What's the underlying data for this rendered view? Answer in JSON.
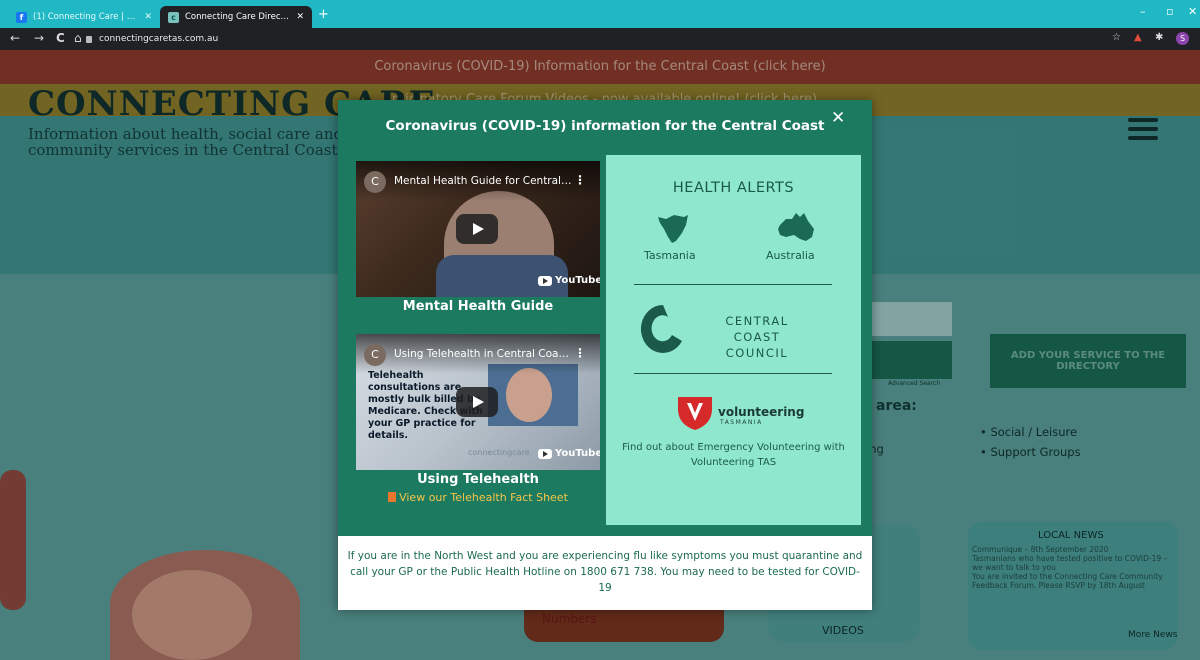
{
  "browser": {
    "tabs": [
      {
        "title": "(1) Connecting Care | Facebook",
        "favicon": "facebook-icon",
        "close": "✕"
      },
      {
        "title": "Connecting Care Directory – Find",
        "favicon": "site-icon",
        "close": "✕"
      }
    ],
    "url": "connectingcaretas.com.au",
    "profile_initial": "S"
  },
  "page": {
    "banner_covid": "Coronavirus (COVID-19) Information for the Central Coast (click here)",
    "banner_forum": "Anticipatory Care Forum Videos - now available online! (click here)",
    "logo_title": "CONNECTING CARE",
    "logo_subtitle": "Information about health, social care and community services in the Central Coast",
    "advanced_search": "Advanced Search",
    "add_service": "ADD YOUR SERVICE TO THE DIRECTORY",
    "area_heading": "area:",
    "categories": [
      "Social / Leisure",
      "Support Groups"
    ],
    "category_fragments": [
      "s",
      "ing"
    ],
    "numbers_label": "Numbers",
    "videos_label": "VIDEOS",
    "news": {
      "title": "LOCAL NEWS",
      "items": [
        "Communique – 8th September 2020",
        "Tasmanians who have tested positive to COVID-19 – we want to talk to you",
        "You are invited to the Connecting Care Community Feedback Forum. Please RSVP by 18th August"
      ],
      "more": "More News"
    }
  },
  "modal": {
    "title": "Coronavirus (COVID-19) information for the Central Coast",
    "close": "✕",
    "videos": [
      {
        "channel_initial": "C",
        "title": "Mental Health Guide for Central…",
        "caption": "Mental Health Guide",
        "brand": "YouTube"
      },
      {
        "channel_initial": "C",
        "title": "Using Telehealth in Central Coa…",
        "caption": "Using Telehealth",
        "brand": "YouTube",
        "overlay_text": "Telehealth consultations are mostly bulk billed by Medicare. Check with your GP practice for details.",
        "watermark": "connectingcare"
      }
    ],
    "fact_sheet_link": "View our Telehealth Fact Sheet",
    "alerts": {
      "title": "HEALTH ALERTS",
      "regions": [
        "Tasmania",
        "Australia"
      ],
      "council_name": "CENTRAL COAST COUNCIL",
      "volunteering_name": "volunteering",
      "volunteering_sub": "TASMANIA",
      "footer": "Find out about Emergency Volunteering with Volunteering TAS"
    },
    "notice": "If you are in the North West and you are experiencing flu like symptoms you must quarantine and call your GP or the Public Health Hotline on 1800 671 738. You may need to be tested for COVID-19"
  },
  "colors": {
    "modal_bg": "#1b7a5f",
    "alerts_bg": "#8fe8cd",
    "tab_bar": "#1fb8c4",
    "link_gold": "#f6c54a"
  }
}
